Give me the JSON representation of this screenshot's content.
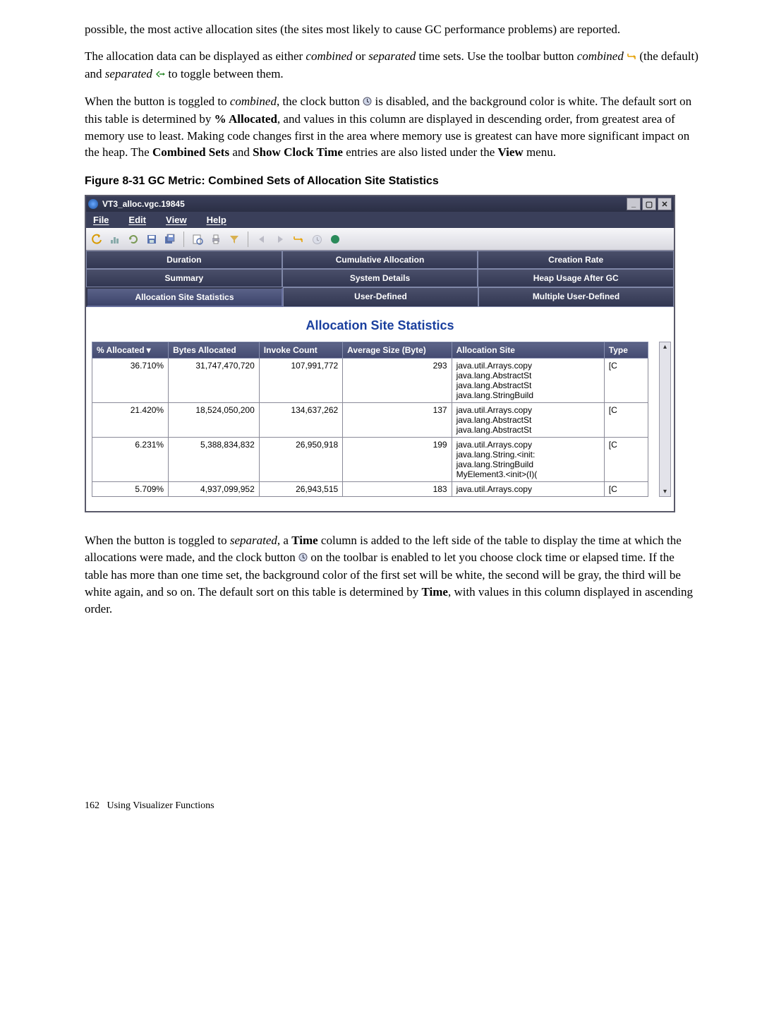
{
  "body": {
    "p1a": "possible, the most active allocation sites (the sites most likely to cause GC performance problems) are reported.",
    "p2a": "The allocation data can be displayed as either ",
    "p2b": "combined",
    "p2c": " or ",
    "p2d": "separated",
    "p2e": " time sets. Use the toolbar button ",
    "p2f": "combined",
    "p2g": " (the default) and ",
    "p2h": "separated",
    "p2i": " to toggle between them.",
    "p3a": "When the button is toggled to ",
    "p3b": "combined",
    "p3c": ", the clock button ",
    "p3d": " is disabled, and the background color is white. The default sort on this table is determined by ",
    "p3e": "% Allocated",
    "p3f": ", and values in this column are displayed in descending order, from greatest area of memory use to least. Making code changes first in the area where memory use is greatest can have more significant impact on the heap. The ",
    "p3g": "Combined Sets",
    "p3h": " and ",
    "p3i": "Show Clock Time",
    "p3j": " entries are also listed under the ",
    "p3k": "View",
    "p3l": " menu.",
    "p4a": "When the button is toggled to ",
    "p4b": "separated",
    "p4c": ", a ",
    "p4d": "Time",
    "p4e": " column is added to the left side of the table to display the time at which the allocations were made, and the clock button ",
    "p4f": " on the toolbar is enabled to let you choose clock time or elapsed time. If the table has more than one time set, the background color of the first set will be white, the second will be gray, the third will be white again, and so on. The default sort on this table is determined by ",
    "p4g": "Time",
    "p4h": ", with values in this column displayed in ascending order."
  },
  "figcap": "Figure 8-31 GC Metric: Combined Sets of Allocation Site Statistics",
  "footer": {
    "pagenum": "162",
    "chapter": "Using Visualizer Functions"
  },
  "window": {
    "title": "VT3_alloc.vgc.19845",
    "menus": {
      "file": "File",
      "edit": "Edit",
      "view": "View",
      "help": "Help"
    },
    "tabs_row1": {
      "duration": "Duration",
      "cumalloc": "Cumulative Allocation",
      "crate": "Creation Rate"
    },
    "tabs_row2": {
      "summary": "Summary",
      "sysdetails": "System Details",
      "heapusage": "Heap Usage After GC"
    },
    "tabs_row3": {
      "allocsite": "Allocation Site Statistics",
      "userdef": "User-Defined",
      "multidef": "Multiple User-Defined"
    },
    "section_title": "Allocation Site Statistics",
    "columns": {
      "pct": "% Allocated",
      "bytes": "Bytes Allocated",
      "invoke": "Invoke Count",
      "avgsize": "Average Size (Byte)",
      "site": "Allocation Site",
      "type": "Type"
    },
    "rows": [
      {
        "pct": "36.710%",
        "bytes": "31,747,470,720",
        "invoke": "107,991,772",
        "avg": "293",
        "site": "java.util.Arrays.copy\njava.lang.AbstractSt\njava.lang.AbstractSt\njava.lang.StringBuild",
        "type": "[C"
      },
      {
        "pct": "21.420%",
        "bytes": "18,524,050,200",
        "invoke": "134,637,262",
        "avg": "137",
        "site": "java.util.Arrays.copy\njava.lang.AbstractSt\njava.lang.AbstractSt",
        "type": "[C"
      },
      {
        "pct": "6.231%",
        "bytes": "5,388,834,832",
        "invoke": "26,950,918",
        "avg": "199",
        "site": "java.util.Arrays.copy\njava.lang.String.<init:\njava.lang.StringBuild\nMyElement3.<init>(I)(",
        "type": "[C"
      },
      {
        "pct": "5.709%",
        "bytes": "4,937,099,952",
        "invoke": "26,943,515",
        "avg": "183",
        "site": "java.util.Arrays.copy",
        "type": "[C"
      }
    ]
  }
}
